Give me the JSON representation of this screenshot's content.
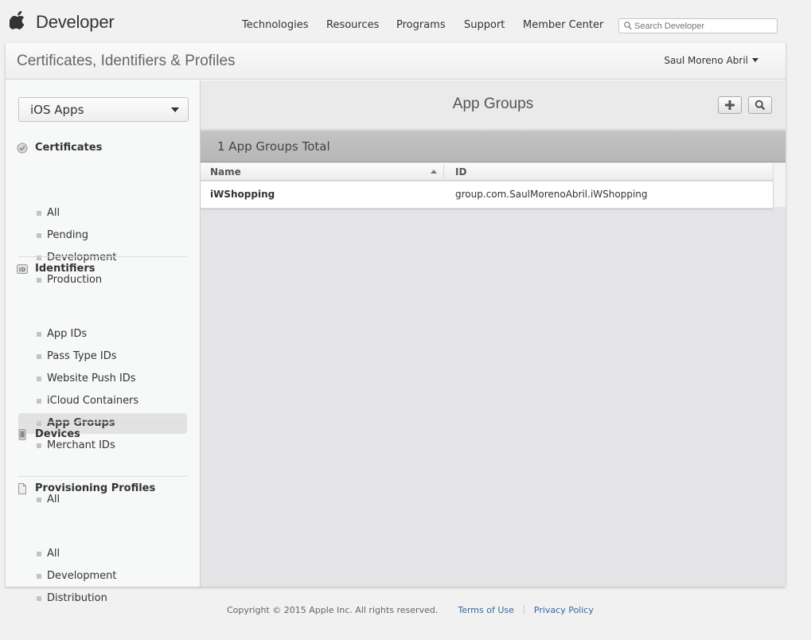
{
  "topnav": {
    "brand": "Developer",
    "links": [
      "Technologies",
      "Resources",
      "Programs",
      "Support",
      "Member Center"
    ],
    "search_placeholder": "Search Developer"
  },
  "header": {
    "title": "Certificates, Identifiers & Profiles",
    "user": "Saul Moreno Abril"
  },
  "sidebar": {
    "platform": "iOS Apps",
    "certificates": {
      "title": "Certificates",
      "items": [
        "All",
        "Pending",
        "Development",
        "Production"
      ]
    },
    "identifiers": {
      "title": "Identifiers",
      "items": [
        "App IDs",
        "Pass Type IDs",
        "Website Push IDs",
        "iCloud Containers",
        "App Groups",
        "Merchant IDs"
      ],
      "active": "App Groups"
    },
    "devices": {
      "title": "Devices",
      "items": [
        "All"
      ]
    },
    "profiles": {
      "title": "Provisioning Profiles",
      "items": [
        "All",
        "Development",
        "Distribution"
      ]
    }
  },
  "main": {
    "title": "App Groups",
    "total": "1 App Groups Total",
    "columns": [
      "Name",
      "ID"
    ],
    "rows": [
      {
        "name": "iWShopping",
        "id": "group.com.SaulMorenoAbril.iWShopping"
      }
    ]
  },
  "footer": {
    "copyright": "Copyright © 2015 Apple Inc. All rights reserved.",
    "terms": "Terms of Use",
    "privacy": "Privacy Policy"
  },
  "colors": {
    "link": "#2f6aa6",
    "active_item_bg": "#e2e2e2",
    "content_bg": "#e4e4e6"
  }
}
